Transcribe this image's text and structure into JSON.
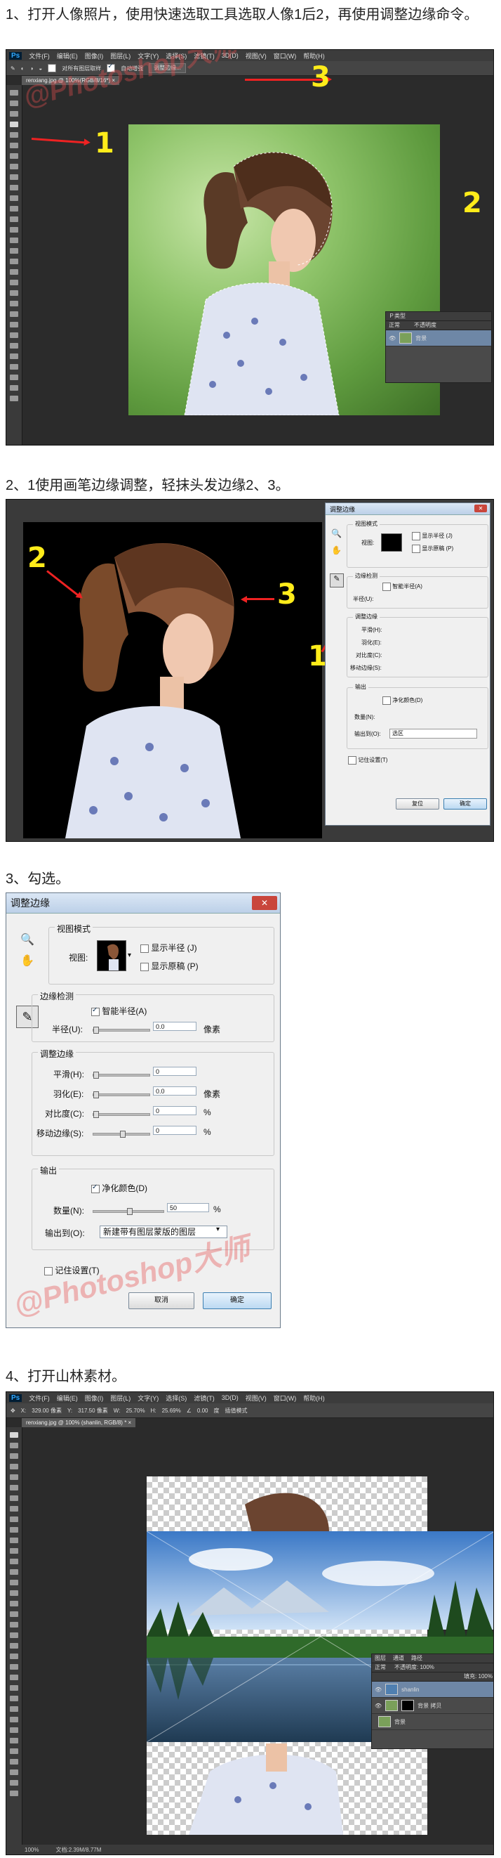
{
  "steps": {
    "s1": {
      "title": "1、打开人像照片，使用快速选取工具选取人像1后2，再使用调整边缘命令。"
    },
    "s2": {
      "title": "2、1使用画笔边缘调整，轻抹头发边缘2、3。"
    },
    "s3": {
      "title": "3、勾选。"
    },
    "s4": {
      "title": "4、打开山林素材。"
    }
  },
  "ps": {
    "logo": "Ps",
    "menu": [
      "文件(F)",
      "编辑(E)",
      "图像(I)",
      "图层(L)",
      "文字(Y)",
      "选择(S)",
      "滤镜(T)",
      "3D(D)",
      "视图(V)",
      "窗口(W)",
      "帮助(H)"
    ],
    "opt1": {
      "sample_all": "对所有图层取样",
      "auto_enhance": "自动增强",
      "refine": "调整边缘..."
    },
    "tab1": "renxiang.jpg @ 100%(RGB/8/16*) ×",
    "tab4": "renxiang.jpg @ 100% (shanlin, RGB/8) * ×",
    "opt4": {
      "x": "329.00 像素",
      "y": "317.50 像素",
      "w": "25.70%",
      "h": "25.69%",
      "angle": "0.00",
      "interp": "度",
      "warp": "插值模式"
    },
    "status4": {
      "zoom": "100%",
      "doc": "文档:2.39M/8.77M"
    }
  },
  "annotations": {
    "n1": "1",
    "n2": "2",
    "n3": "3"
  },
  "layers1": {
    "header": "Ｐ类型",
    "mode": "正常",
    "opacity": "不透明度",
    "layer": "背景"
  },
  "layers4": {
    "tabs": [
      "图层",
      "通道",
      "路径"
    ],
    "mode": "正常",
    "opacity": "不透明度: 100%",
    "fill": "填充: 100%",
    "items": [
      "shanlin",
      "背景 拷贝",
      "背景"
    ]
  },
  "refine": {
    "title": "调整边缘",
    "view_mode": "视图模式",
    "view": "视图:",
    "show_radius": "显示半径 (J)",
    "show_original": "显示原稿 (P)",
    "edge_detect": "边缘检测",
    "smart_radius": "智能半径(A)",
    "radius": "半径(U):",
    "radius_val": "0.0",
    "px": "像素",
    "adjust_edge": "调整边缘",
    "smooth": "平滑(H):",
    "smooth_val": "0",
    "feather": "羽化(E):",
    "feather_val": "0.0",
    "contrast": "对比度(C):",
    "contrast_val": "0",
    "shift": "移动边缘(S):",
    "shift_val": "0",
    "pct": "%",
    "output": "输出",
    "decon": "净化颜色(D)",
    "amount": "数量(N):",
    "amount_val": "50",
    "output_to": "输出到(O):",
    "output_to_val_small": "选区",
    "output_to_val": "新建带有图层蒙版的图层",
    "remember": "记住设置(T)",
    "cancel": "复位",
    "cancel_big": "取消",
    "ok": "确定"
  },
  "watermark": "@Photoshop大师"
}
